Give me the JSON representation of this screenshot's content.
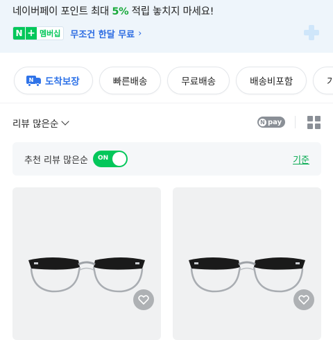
{
  "promo": {
    "line1_pre": "네이버페이 포인트 최대 ",
    "line1_pct": "5%",
    "line1_post": " 적립 놓치지 마세요!",
    "badge_n": "N",
    "badge_plus": "+",
    "badge_text": "멤버십",
    "cta": "무조건 한달 무료",
    "cta_chevron": "›"
  },
  "chips": [
    {
      "label": "도착보장",
      "icon": "truck-icon"
    },
    {
      "label": "빠른배송"
    },
    {
      "label": "무료배송"
    },
    {
      "label": "배송비포함"
    },
    {
      "label": "가격"
    }
  ],
  "sort": {
    "label": "리뷰 많은순",
    "npay_n": "N",
    "npay_text": "pay"
  },
  "recommend": {
    "label": "추천 리뷰 많은순",
    "toggle_text": "ON",
    "toggle_on": true,
    "link": "기준"
  },
  "products": [
    {
      "image": "glasses-photo",
      "heart_icon": "heart-icon"
    },
    {
      "image": "glasses-photo",
      "heart_icon": "heart-icon"
    }
  ],
  "colors": {
    "naver_green": "#03c75a",
    "link_blue": "#2b6be2",
    "banner_bg": "#eef5fb",
    "card_bg": "#f0f1f2"
  }
}
